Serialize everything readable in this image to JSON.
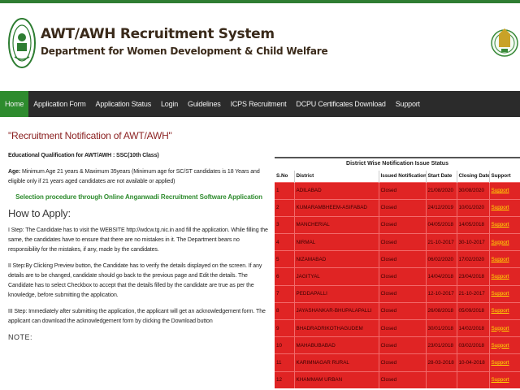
{
  "header": {
    "title": "AWT/AWH Recruitment System",
    "subtitle": "Department for Women Development & Child Welfare",
    "left_logo": "telangana-seal-icon",
    "right_logo": "telangana-emblem-icon"
  },
  "colors": {
    "nav_bg": "#2b2b2b",
    "nav_active": "#2e8b2e",
    "table_row": "#e02424",
    "support_link": "#ffe000",
    "title_red": "#8a1f1f",
    "green_text": "#2e8b2e"
  },
  "nav": [
    {
      "label": "Home",
      "active": true
    },
    {
      "label": "Application Form"
    },
    {
      "label": "Application Status"
    },
    {
      "label": "Login"
    },
    {
      "label": "Guidelines"
    },
    {
      "label": "ICPS Recruitment"
    },
    {
      "label": "DCPU Certificates Download"
    },
    {
      "label": "Support"
    }
  ],
  "main": {
    "title": "\"Recruitment Notification of AWT/AWH\"",
    "qualification_label": "Educational Qualification for AWT/AWH :",
    "qualification_value": "SSC(10th Class)",
    "age_label": "Age:",
    "age_text": "Minimum Age 21 years & Maximum 35years (Minimum age for SC/ST candidates is 18 Years and eligible only if 21 years aged candidates are not available or applied)",
    "procedure": "Selection procedure through Online Anganwadi Recruitment Software Application",
    "how_to_apply": "How to Apply:",
    "steps": [
      "I Step: The Candidate has to visit the WEBSITE http://wdcw.tg.nic.in and fill the application. While filling the same, the candidates have to ensure that there are no mistakes in it. The Department bears no responsibility for the mistakes, if any, made by the candidates.",
      "II Step:By Clicking Preview button, the Candidate has to verify the details displayed on the screen. If any details are to be changed, candidate should go back to the previous page and Edit the details. The Candidate has to select Checkbox to accept that the details filled by the candidate are true as per the knowledge, before submitting the application.",
      "III Step: Immediately after submitting the application, the applicant will get an acknowledgement form. The applicant can download the acknowledgement form by clicking the Download button"
    ],
    "note": "NOTE:"
  },
  "status_table": {
    "title": "District Wise Notification Issue Status",
    "columns": [
      "S.No",
      "District",
      "Issued Notification",
      "Start Date",
      "Closing Date",
      "Support"
    ],
    "rows": [
      [
        "1",
        "ADILABAD",
        "Closed",
        "21/08/2020",
        "30/08/2020",
        "Support"
      ],
      [
        "2",
        "KUMARAMBHEEM-ASIFABAD",
        "Closed",
        "24/12/2019",
        "10/01/2020",
        "Support"
      ],
      [
        "3",
        "MANCHERIAL",
        "Closed",
        "04/05/2018",
        "14/05/2018",
        "Support"
      ],
      [
        "4",
        "NIRMAL",
        "Closed",
        "21-10-2017",
        "30-10-2017",
        "Support"
      ],
      [
        "5",
        "NIZAMABAD",
        "Closed",
        "06/02/2020",
        "17/02/2020",
        "Support"
      ],
      [
        "6",
        "JAGITYAL",
        "Closed",
        "14/04/2018",
        "23/04/2018",
        "Support"
      ],
      [
        "7",
        "PEDDAPALLI",
        "Closed",
        "12-10-2017",
        "21-10-2017",
        "Support"
      ],
      [
        "8",
        "JAYASHANKAR-BHUPALAPALLI",
        "Closed",
        "26/08/2018",
        "05/09/2018",
        "Support"
      ],
      [
        "9",
        "BHADRADRIKOTHAGUDEM",
        "Closed",
        "30/01/2018",
        "14/02/2018",
        "Support"
      ],
      [
        "10",
        "MAHABUBABAD",
        "Closed",
        "23/01/2018",
        "03/02/2018",
        "Support"
      ],
      [
        "11",
        "KARIMNAGAR RURAL",
        "Closed",
        "28-03-2018",
        "10-04-2018",
        "Support"
      ],
      [
        "12",
        "KHAMMAM URBAN",
        "Closed",
        "",
        "",
        "Support"
      ]
    ]
  }
}
